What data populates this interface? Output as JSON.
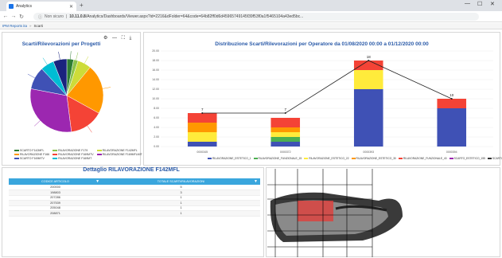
{
  "browser": {
    "tab_title": "Analytics",
    "url_scheme": "Non sicuro",
    "url_host": "10.11.0.8",
    "url_path": "/Analytics/Dashboards/Viewer.aspx?id=2216&dFolder=64&code=64b82ff0d6d45965749145f39f53f0a1f5465104a43ed5bc...",
    "new_tab": "+",
    "win_min": "—",
    "win_max": "☐",
    "win_close": "✕"
  },
  "breadcrumb": {
    "root": "IPM Reports ita",
    "current": "Scarti"
  },
  "pie": {
    "title": "Scarti/Rilevorazioni per Progetti",
    "tools": "⚙ — ⛶ ⤓"
  },
  "bar": {
    "title": "Distribuzione Scarti/Rilevorazioni per Operatore da 01/08/2020 00:00 a 01/12/2020 00:00"
  },
  "table": {
    "title": "Dettaglio RILAVORAZIONE F142MFL",
    "columns": [
      "CODICE ARTICOLO",
      "TOTALE SCARTI/RILAVORAZIONI"
    ],
    "rows": [
      [
        "200000",
        "5"
      ],
      [
        "198803",
        "3"
      ],
      [
        "207286",
        "1"
      ],
      [
        "207539",
        "1"
      ],
      [
        "205048",
        "1"
      ],
      [
        "208871",
        "1"
      ]
    ]
  },
  "chart_data": [
    {
      "type": "pie",
      "title": "Scarti/Rilevorazioni per Progetti",
      "slices": [
        {
          "label": "",
          "value": 3,
          "color": "#2e7d32"
        },
        {
          "label": "",
          "value": 2,
          "color": "#8bc34a"
        },
        {
          "label": "",
          "value": 6,
          "color": "#cddc39"
        },
        {
          "label": "",
          "value": 22,
          "color": "#ff9800"
        },
        {
          "label": "",
          "value": 15,
          "color": "#f44336"
        },
        {
          "label": "",
          "value": 30,
          "color": "#9c27b0"
        },
        {
          "label": "",
          "value": 10,
          "color": "#3f51b5"
        },
        {
          "label": "",
          "value": 6,
          "color": "#00bcd4"
        },
        {
          "label": "",
          "value": 6,
          "color": "#1a237e"
        }
      ],
      "legend": [
        "SCARTO F142MFL",
        "RILAVORAZIONE F179",
        "RILAVORAZIONE F142MFL",
        "RILAVORAZIONE F166",
        "RILAVORAZIONE F169MTV",
        "RILAVORAZIONE F169MFLMIT",
        "SCARTO F169MTV",
        "RILAVORAZIONE F169MT"
      ]
    },
    {
      "type": "bar",
      "title": "Distribuzione Scarti/Rilevorazioni per Operatore da 01/08/2020 00:00 a 01/12/2020 00:00",
      "categories": [
        "0000345",
        "0000372",
        "0000393",
        "0000394"
      ],
      "ylim": [
        0,
        20
      ],
      "yticks": [
        "0.00",
        "2.00",
        "4.00",
        "6.00",
        "8.00",
        "10.00",
        "12.00",
        "14.00",
        "16.00",
        "18.00",
        "20.00"
      ],
      "series": [
        {
          "name": "RILAVORAZIONE_ESTETICO_1",
          "color": "#3f51b5",
          "values": [
            1,
            1,
            12,
            8
          ]
        },
        {
          "name": "RILAVORAZIONE_FUNZIONALE_15",
          "color": "#4caf50",
          "values": [
            0,
            1,
            0,
            0
          ]
        },
        {
          "name": "RILAVORAZIONE_ESTETICO_22",
          "color": "#ffeb3b",
          "values": [
            2,
            1,
            4,
            0
          ]
        },
        {
          "name": "RILAVORAZIONE_ESTETICO_30",
          "color": "#ff9800",
          "values": [
            2,
            1,
            0,
            0
          ]
        },
        {
          "name": "RILAVORAZIONE_FUNZIONALE_40",
          "color": "#f44336",
          "values": [
            2,
            2,
            2,
            2
          ]
        }
      ],
      "line": {
        "name": "SCARTI_TOTALI",
        "values": [
          7,
          7,
          18,
          10
        ]
      },
      "legend": [
        "RILAVORAZIONE_ESTETICO_1",
        "RILAVORAZIONE_FUNZIONALE_15",
        "RILAVORAZIONE_ESTETICO_22",
        "RILAVORAZIONE_ESTETICO_30",
        "RILAVORAZIONE_FUNZIONALE_40",
        "SCARTO_ESTETICO_155",
        "SCARTI_TOTALI"
      ],
      "legend_colors": [
        "#3f51b5",
        "#4caf50",
        "#ffeb3b",
        "#ff9800",
        "#f44336",
        "#9c27b0",
        "#333333"
      ]
    }
  ]
}
